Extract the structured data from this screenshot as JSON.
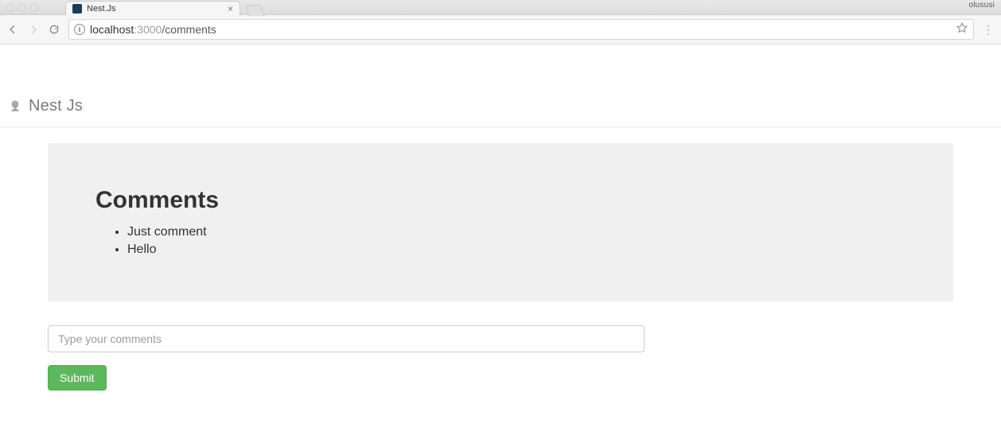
{
  "browser": {
    "tabs": [
      {
        "title": "Nest.Js"
      }
    ],
    "profile_label": "olususi",
    "url": {
      "host": "localhost",
      "port": ":3000",
      "path": "/comments"
    }
  },
  "page": {
    "brand": "Nest Js",
    "comments": {
      "heading": "Comments",
      "items": [
        "Just comment",
        "Hello"
      ]
    },
    "form": {
      "input_placeholder": "Type your comments",
      "submit_label": "Submit"
    }
  }
}
